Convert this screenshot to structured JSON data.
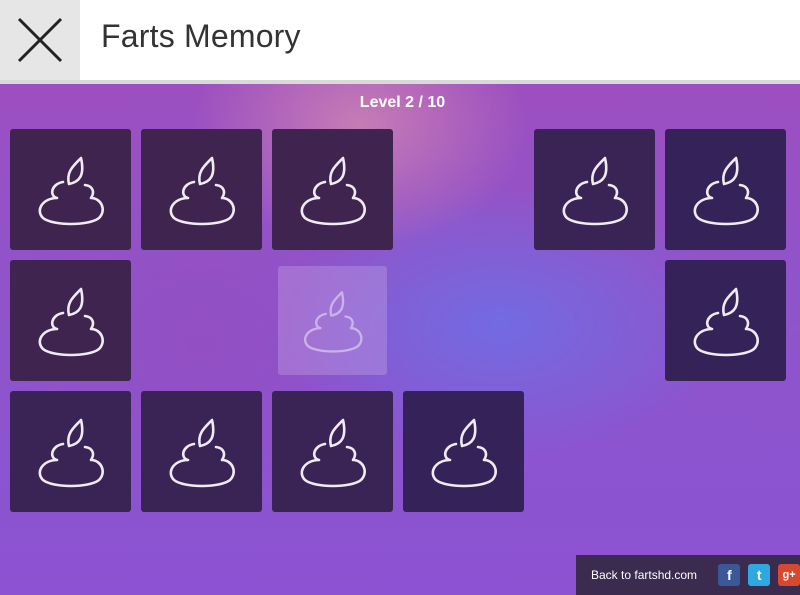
{
  "app": {
    "title": "Farts Memory"
  },
  "game": {
    "level_label": "Level 2 / 10",
    "cards": [
      {
        "state": "facedown"
      },
      {
        "state": "facedown"
      },
      {
        "state": "facedown"
      },
      {
        "state": "empty"
      },
      {
        "state": "facedown"
      },
      {
        "state": "facedown"
      },
      {
        "state": "facedown"
      },
      {
        "state": "empty"
      },
      {
        "state": "selected"
      },
      {
        "state": "empty"
      },
      {
        "state": "empty"
      },
      {
        "state": "facedown"
      },
      {
        "state": "facedown"
      },
      {
        "state": "facedown"
      },
      {
        "state": "facedown"
      },
      {
        "state": "facedown"
      },
      {
        "state": "empty"
      },
      {
        "state": "empty"
      }
    ],
    "card_icon": "poop-icon"
  },
  "footer": {
    "back_link": "Back to fartshd.com",
    "facebook_glyph": "f",
    "twitter_glyph": "t",
    "googleplus_glyph": "g+"
  },
  "colors": {
    "card_back": "#3f2450",
    "background": "#8d55cc"
  }
}
